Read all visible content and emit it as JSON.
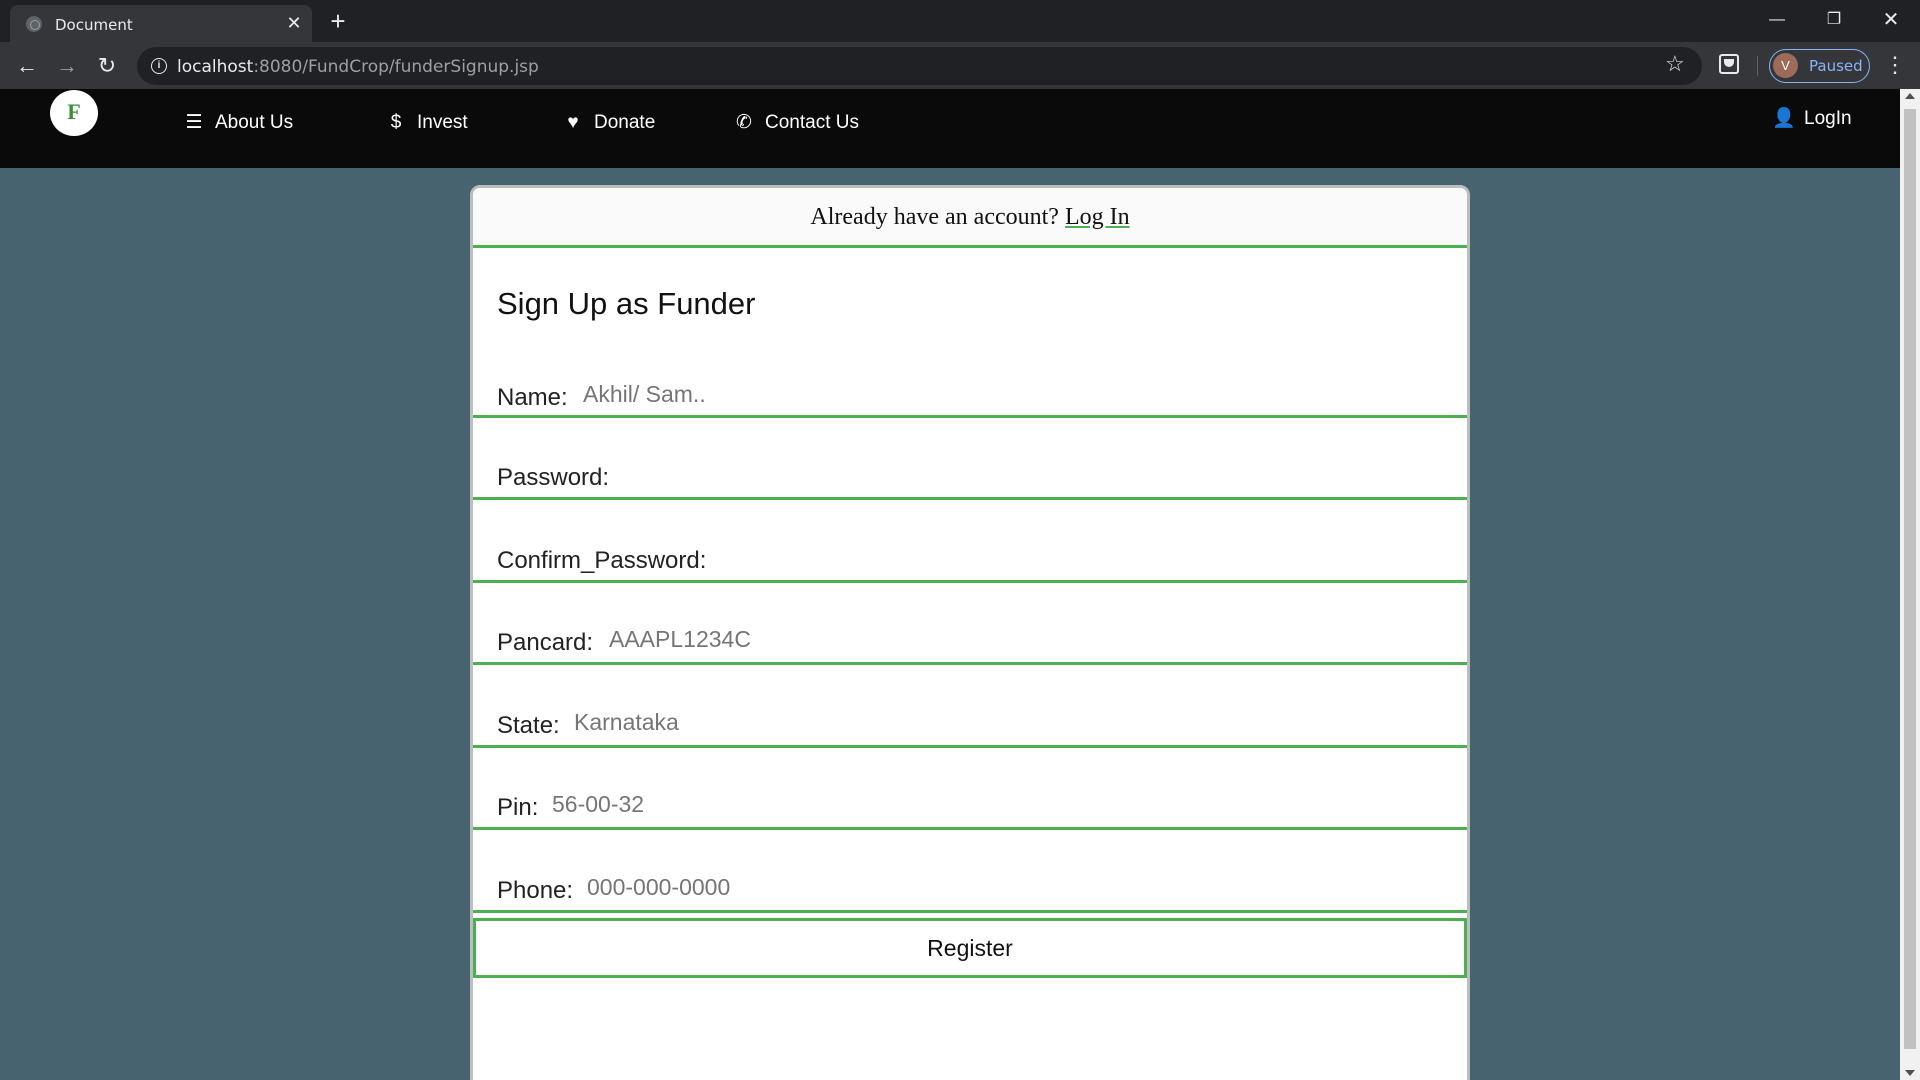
{
  "browser": {
    "tab_title": "Document",
    "url_host": "localhost",
    "url_path": ":8080/FundCrop/funderSignup.jsp",
    "profile_initial": "V",
    "profile_status": "Paused"
  },
  "navbar": {
    "logo_letter": "F",
    "items": [
      {
        "label": "About Us",
        "icon": "bars-icon"
      },
      {
        "label": "Invest",
        "icon": "dollar-icon"
      },
      {
        "label": "Donate",
        "icon": "heart-icon"
      },
      {
        "label": "Contact Us",
        "icon": "phone-icon"
      }
    ],
    "login_label": "LogIn"
  },
  "form": {
    "already_text": "Already have an account?",
    "login_link": "Log In",
    "title": "Sign Up as Funder",
    "fields": [
      {
        "label": "Name:",
        "placeholder": "Akhil/ Sam.."
      },
      {
        "label": "Password:",
        "placeholder": ""
      },
      {
        "label": "Confirm_Password:",
        "placeholder": ""
      },
      {
        "label": "Pancard:",
        "placeholder": "AAAPL1234C"
      },
      {
        "label": "State:",
        "placeholder": "Karnataka"
      },
      {
        "label": "Pin:",
        "placeholder": "56-00-32"
      },
      {
        "label": "Phone:",
        "placeholder": "000-000-0000"
      }
    ],
    "register_label": "Register"
  },
  "colors": {
    "accent": "#4caf50",
    "page_background": "#46636f",
    "navbar_background": "#0a0a0a"
  }
}
